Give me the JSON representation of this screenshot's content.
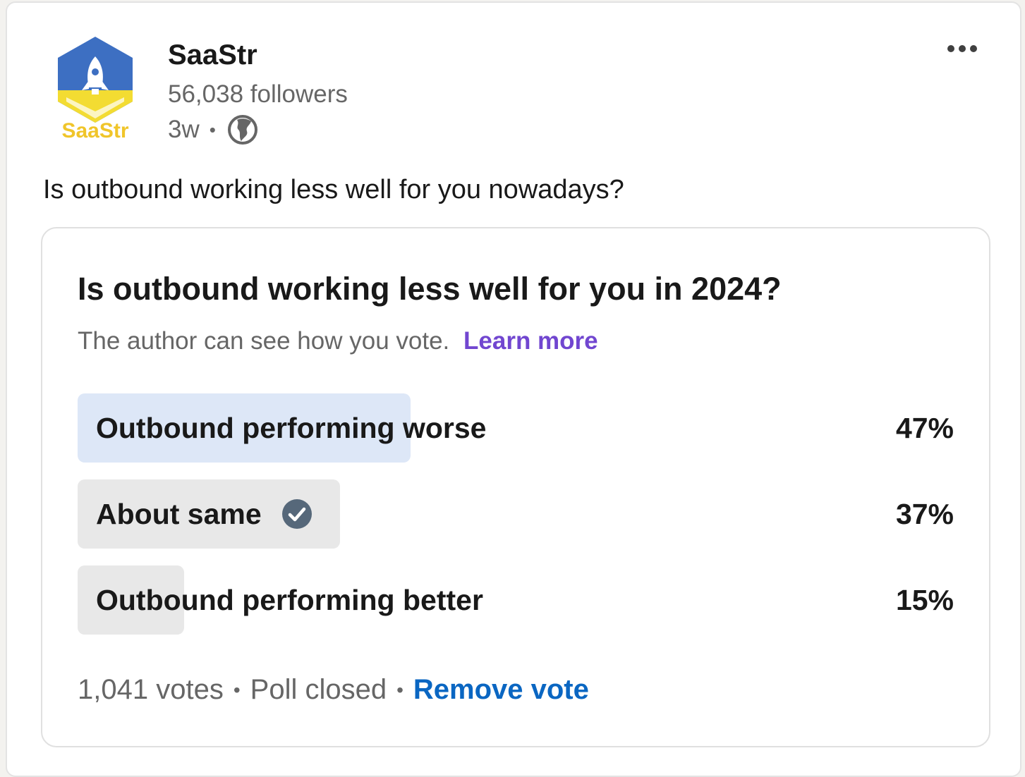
{
  "post": {
    "author": {
      "name": "SaaStr",
      "logo_text": "SaaStr",
      "followers": "56,038 followers",
      "time": "3w",
      "visibility_icon": "globe-icon"
    },
    "menu_icon": "more-horizontal-icon",
    "text": "Is outbound working less well for you nowadays?"
  },
  "poll": {
    "question": "Is outbound working less well for you in 2024?",
    "privacy_note": "The author can see how you vote.",
    "learn_more": "Learn more",
    "options": [
      {
        "label": "Outbound performing worse",
        "percent": "47%",
        "fraction": 0.47,
        "selected": false
      },
      {
        "label": "About same",
        "percent": "37%",
        "fraction": 0.37,
        "selected": true
      },
      {
        "label": "Outbound performing better",
        "percent": "15%",
        "fraction": 0.15,
        "selected": false
      }
    ],
    "votes": "1,041 votes",
    "status": "Poll closed",
    "remove_vote": "Remove vote"
  },
  "colors": {
    "leading_bar": "#dde7f7",
    "other_bar": "#e8e8e8",
    "link_blue": "#0a66c2",
    "learn_more_purple": "#7146d0"
  }
}
